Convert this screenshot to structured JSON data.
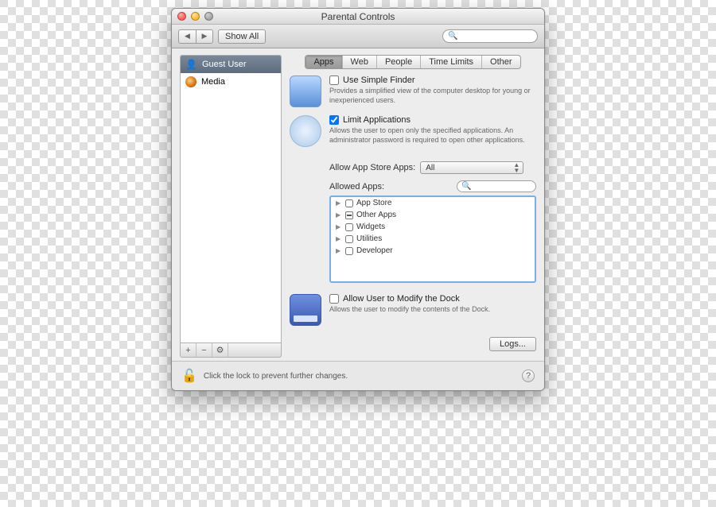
{
  "window": {
    "title": "Parental Controls"
  },
  "toolbar": {
    "show_all": "Show All",
    "search_placeholder": ""
  },
  "sidebar": {
    "users": [
      {
        "name": "Guest User",
        "selected": true
      },
      {
        "name": "Media",
        "selected": false
      }
    ],
    "footer": {
      "add": "+",
      "remove": "−",
      "gear": "✻"
    }
  },
  "tabs": [
    "Apps",
    "Web",
    "People",
    "Time Limits",
    "Other"
  ],
  "active_tab": "Apps",
  "finder": {
    "checkbox_label": "Use Simple Finder",
    "checked": false,
    "desc": "Provides a simplified view of the computer desktop for young or inexperienced users."
  },
  "limit_apps": {
    "checkbox_label": "Limit Applications",
    "checked": true,
    "desc": "Allows the user to open only the specified applications. An administrator password is required to open other applications."
  },
  "appstore_row": {
    "label": "Allow App Store Apps:",
    "value": "All"
  },
  "allowed_apps": {
    "label": "Allowed Apps:",
    "search_placeholder": "",
    "items": [
      {
        "name": "App Store",
        "state": "unchecked"
      },
      {
        "name": "Other Apps",
        "state": "mixed"
      },
      {
        "name": "Widgets",
        "state": "unchecked"
      },
      {
        "name": "Utilities",
        "state": "unchecked"
      },
      {
        "name": "Developer",
        "state": "unchecked"
      }
    ]
  },
  "dock": {
    "checkbox_label": "Allow User to Modify the Dock",
    "checked": false,
    "desc": "Allows the user to modify the contents of the Dock."
  },
  "logs_button": "Logs...",
  "lock_text": "Click the lock to prevent further changes.",
  "help": "?"
}
